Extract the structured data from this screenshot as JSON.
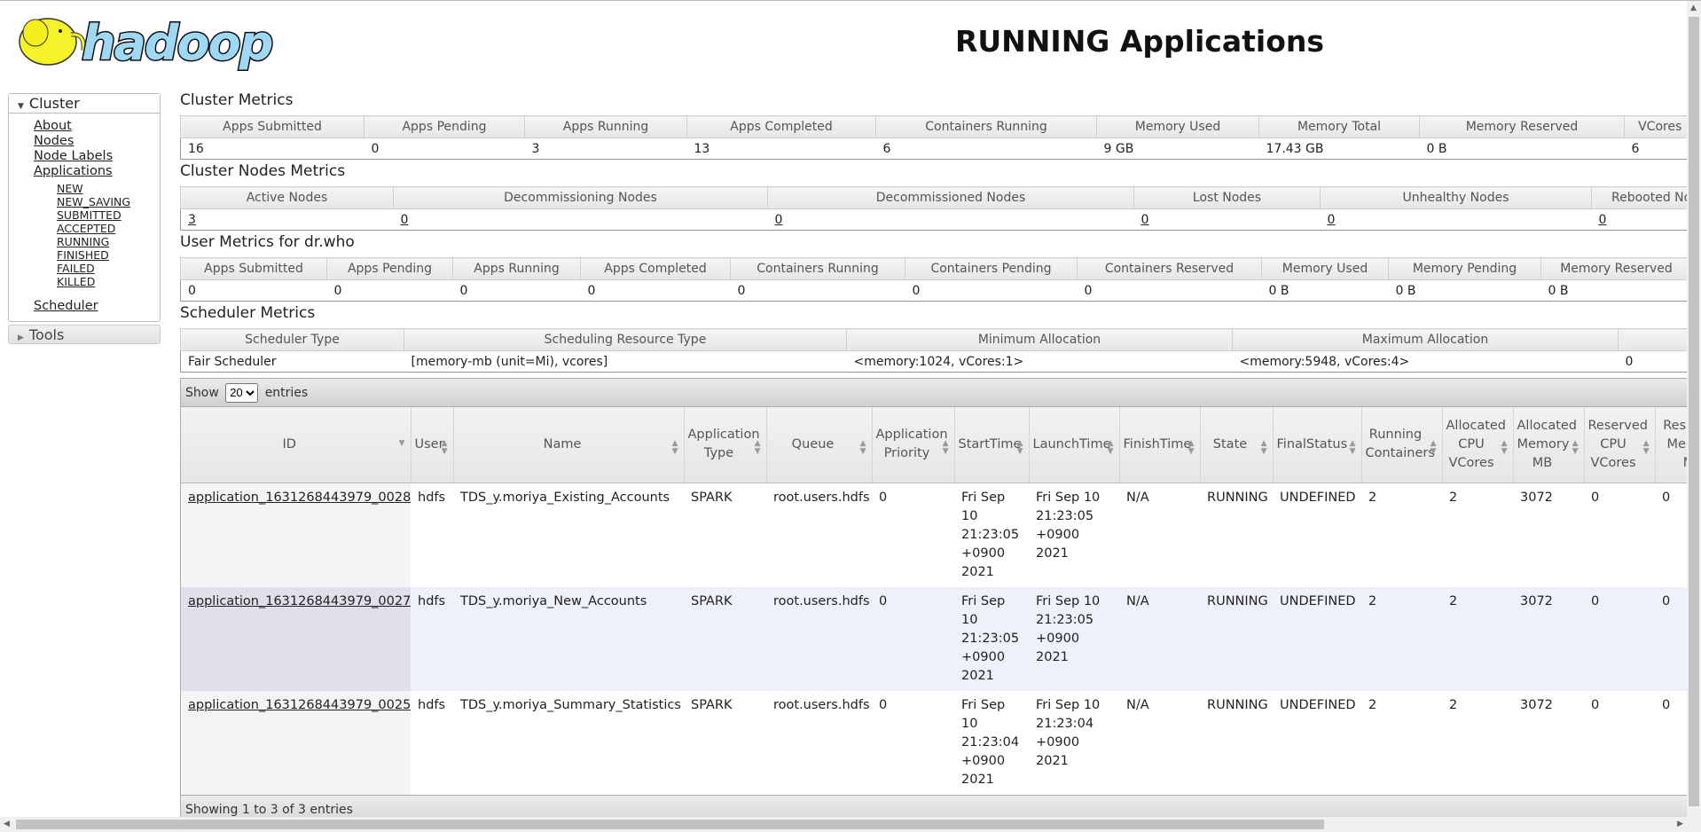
{
  "header": {
    "logo_text": "hadoop",
    "title": "RUNNING Applications"
  },
  "nav": {
    "cluster_label": "Cluster",
    "links": [
      "About",
      "Nodes",
      "Node Labels",
      "Applications"
    ],
    "states": [
      "NEW",
      "NEW_SAVING",
      "SUBMITTED",
      "ACCEPTED",
      "RUNNING",
      "FINISHED",
      "FAILED",
      "KILLED"
    ],
    "scheduler": "Scheduler",
    "tools_label": "Tools"
  },
  "cluster_metrics": {
    "title": "Cluster Metrics",
    "headers": [
      "Apps Submitted",
      "Apps Pending",
      "Apps Running",
      "Apps Completed",
      "Containers Running",
      "Memory Used",
      "Memory Total",
      "Memory Reserved",
      "VCores Used"
    ],
    "values": [
      "16",
      "0",
      "3",
      "13",
      "6",
      "9 GB",
      "17.43 GB",
      "0 B",
      "6"
    ]
  },
  "nodes_metrics": {
    "title": "Cluster Nodes Metrics",
    "headers": [
      "Active Nodes",
      "Decommissioning Nodes",
      "Decommissioned Nodes",
      "Lost Nodes",
      "Unhealthy Nodes",
      "Rebooted Nodes"
    ],
    "values": [
      "3",
      "0",
      "0",
      "0",
      "0",
      "0"
    ]
  },
  "user_metrics": {
    "title": "User Metrics for dr.who",
    "headers": [
      "Apps Submitted",
      "Apps Pending",
      "Apps Running",
      "Apps Completed",
      "Containers Running",
      "Containers Pending",
      "Containers Reserved",
      "Memory Used",
      "Memory Pending",
      "Memory Reserved"
    ],
    "values": [
      "0",
      "0",
      "0",
      "0",
      "0",
      "0",
      "0",
      "0 B",
      "0 B",
      "0 B"
    ]
  },
  "scheduler_metrics": {
    "title": "Scheduler Metrics",
    "headers": [
      "Scheduler Type",
      "Scheduling Resource Type",
      "Minimum Allocation",
      "Maximum Allocation",
      ""
    ],
    "values": [
      "Fair Scheduler",
      "[memory-mb (unit=Mi), vcores]",
      "<memory:1024, vCores:1>",
      "<memory:5948, vCores:4>",
      "0"
    ]
  },
  "apps": {
    "show_label": "Show",
    "entries_label": "entries",
    "page_size": "20",
    "columns": [
      "ID",
      "User",
      "Name",
      "Application Type",
      "Queue",
      "Application Priority",
      "StartTime",
      "LaunchTime",
      "FinishTime",
      "State",
      "FinalStatus",
      "Running Containers",
      "Allocated CPU VCores",
      "Allocated Memory MB",
      "Reserved CPU VCores",
      "Reserved Memory MB"
    ],
    "rows": [
      [
        "application_1631268443979_0028",
        "hdfs",
        "TDS_y.moriya_Existing_Accounts",
        "SPARK",
        "root.users.hdfs",
        "0",
        "Fri Sep 10 21:23:05 +0900 2021",
        "Fri Sep 10 21:23:05 +0900 2021",
        "N/A",
        "RUNNING",
        "UNDEFINED",
        "2",
        "2",
        "3072",
        "0",
        "0"
      ],
      [
        "application_1631268443979_0027",
        "hdfs",
        "TDS_y.moriya_New_Accounts",
        "SPARK",
        "root.users.hdfs",
        "0",
        "Fri Sep 10 21:23:05 +0900 2021",
        "Fri Sep 10 21:23:05 +0900 2021",
        "N/A",
        "RUNNING",
        "UNDEFINED",
        "2",
        "2",
        "3072",
        "0",
        "0"
      ],
      [
        "application_1631268443979_0025",
        "hdfs",
        "TDS_y.moriya_Summary_Statistics",
        "SPARK",
        "root.users.hdfs",
        "0",
        "Fri Sep 10 21:23:04 +0900 2021",
        "Fri Sep 10 21:23:04 +0900 2021",
        "N/A",
        "RUNNING",
        "UNDEFINED",
        "2",
        "2",
        "3072",
        "0",
        "0"
      ]
    ],
    "footer": "Showing 1 to 3 of 3 entries"
  },
  "colors": {
    "logo_blue": "#9fd8f5",
    "logo_yellow": "#f6f22a",
    "row_alt": "#eef0fa"
  }
}
